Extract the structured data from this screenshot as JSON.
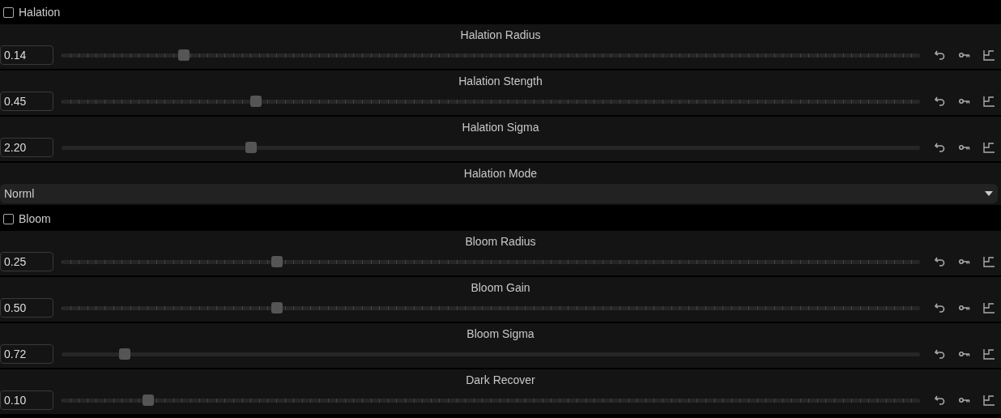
{
  "sections": [
    {
      "label": "Halation",
      "checked": false,
      "items": [
        {
          "kind": "slider",
          "label": "Halation Radius",
          "value": "0.14",
          "level": 0.142,
          "ticked": true
        },
        {
          "kind": "slider",
          "label": "Halation Stength",
          "value": "0.45",
          "level": 0.226,
          "ticked": true
        },
        {
          "kind": "slider",
          "label": "Halation Sigma",
          "value": "2.20",
          "level": 0.221,
          "ticked": false
        },
        {
          "kind": "select",
          "label": "Halation Mode",
          "value": "Norml"
        }
      ]
    },
    {
      "label": "Bloom",
      "checked": false,
      "items": [
        {
          "kind": "slider",
          "label": "Bloom Radius",
          "value": "0.25",
          "level": 0.251,
          "ticked": true
        },
        {
          "kind": "slider",
          "label": "Bloom Gain",
          "value": "0.50",
          "level": 0.251,
          "ticked": true
        },
        {
          "kind": "slider",
          "label": "Bloom Sigma",
          "value": "0.72",
          "level": 0.074,
          "ticked": false
        },
        {
          "kind": "slider",
          "label": "Dark Recover",
          "value": "0.10",
          "level": 0.101,
          "ticked": true
        }
      ]
    }
  ]
}
